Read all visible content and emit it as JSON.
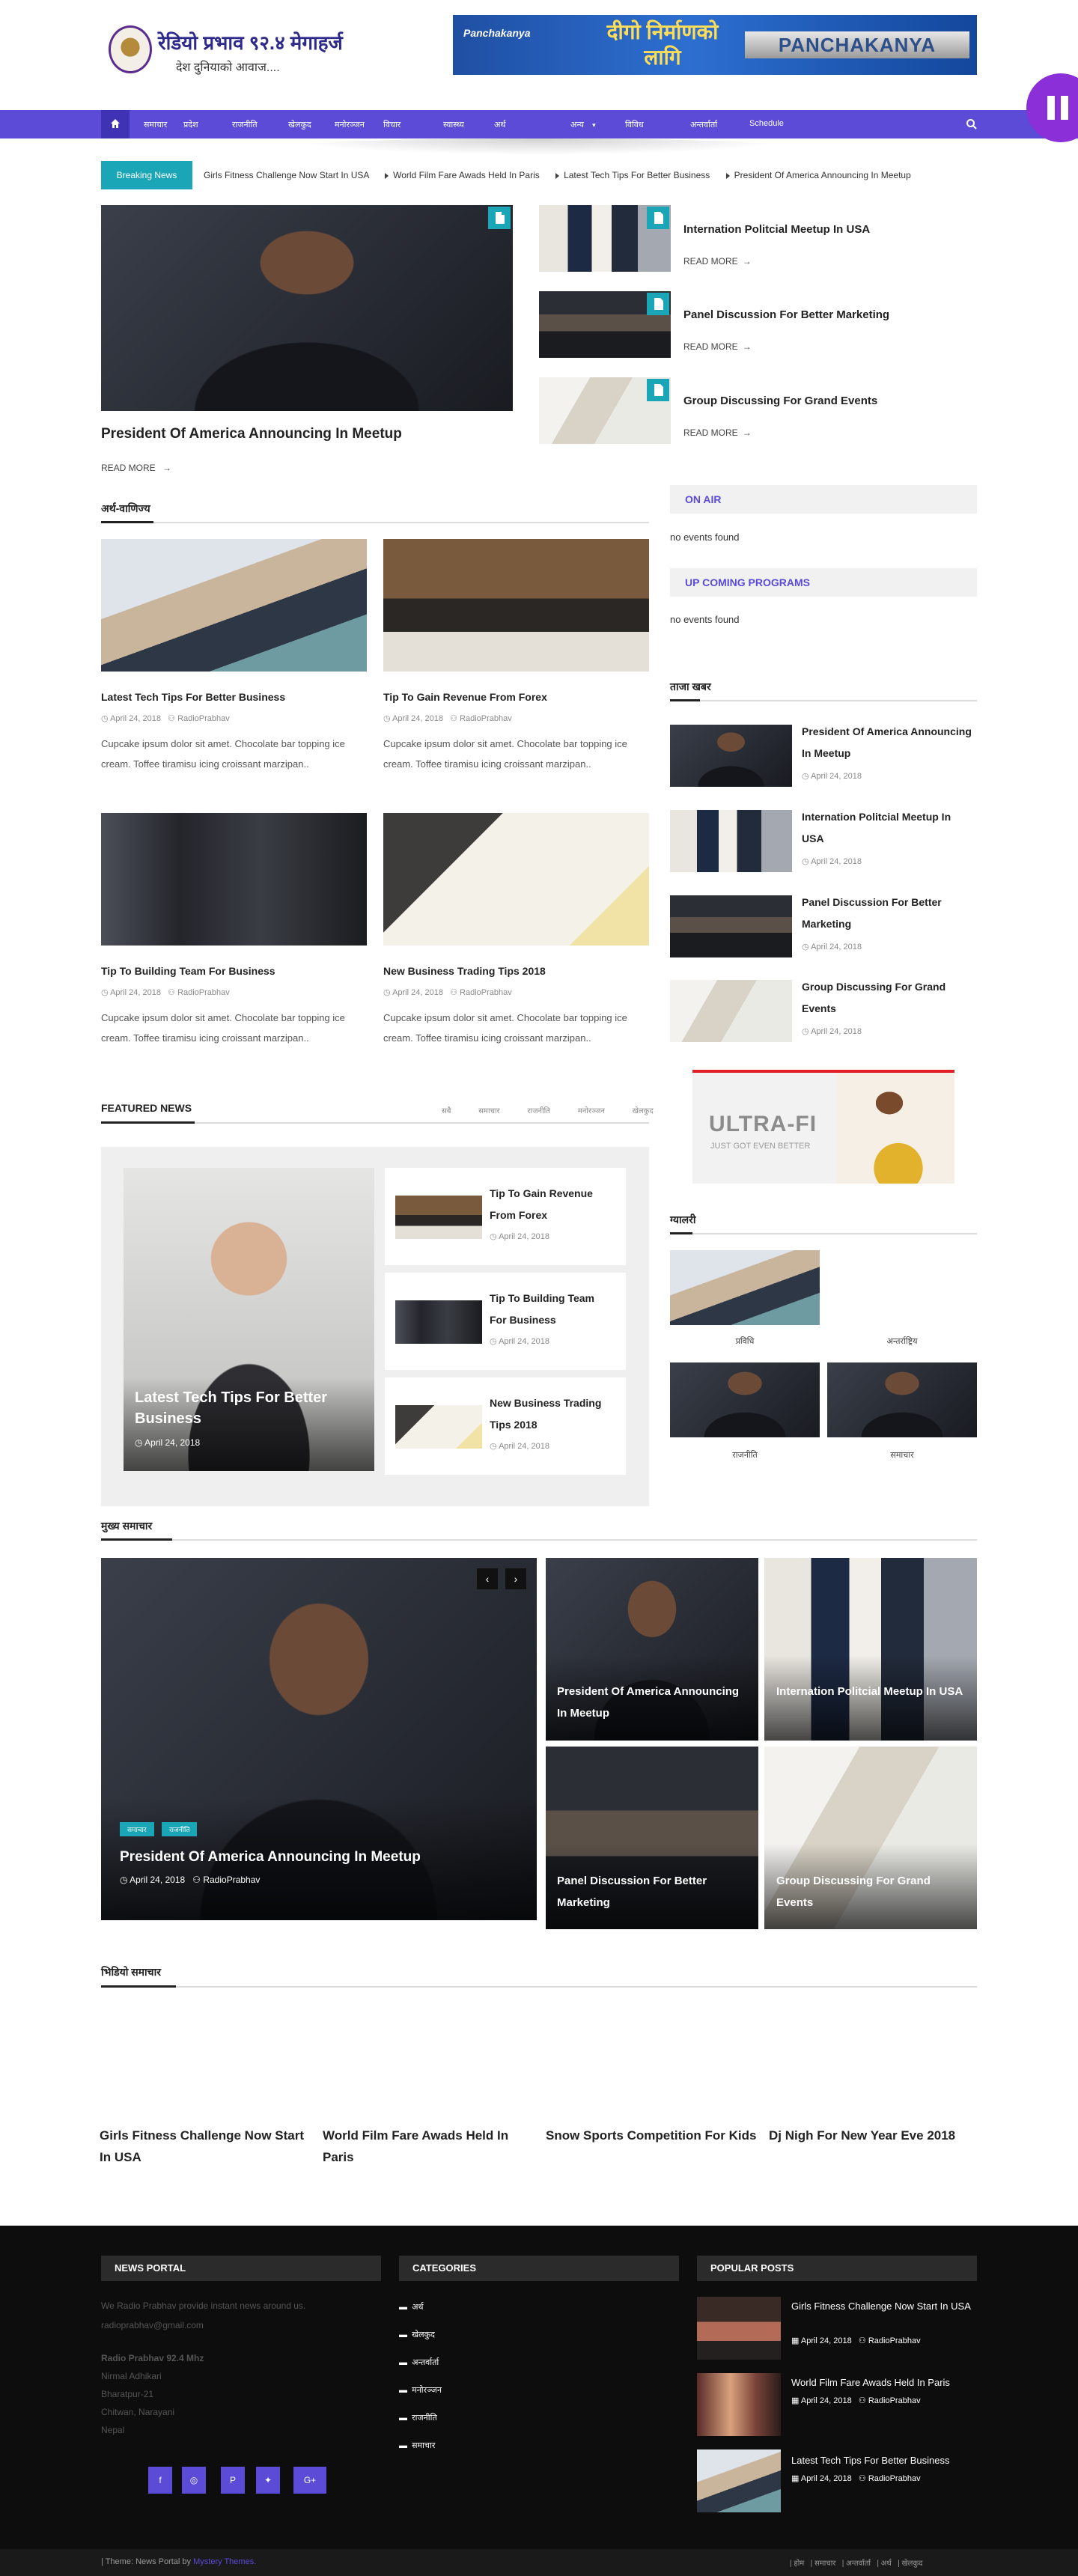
{
  "header": {
    "logo_line1": "रेडियो प्रभाव ९२.४ मेगाहर्ज",
    "logo_line2": "देश दुनियाको आवाज....",
    "ad_brand": "Panchakanya",
    "ad_text": "दीगो निर्माणको लागि",
    "ad_logo": "PANCHAKANYA"
  },
  "nav": {
    "items": [
      "होम",
      "समाचार",
      "प्रदेश",
      "राजनीति",
      "खेलकुद",
      "मनोरञ्जन",
      "विचार",
      "स्वास्थ्य",
      "अर्थ",
      "विविध",
      "अन्तर्वार्ता",
      "Schedule"
    ],
    "more_label": "अन्य"
  },
  "breaking": {
    "label": "Breaking News",
    "items": [
      "Girls Fitness Challenge Now Start In USA",
      "World Film Fare Awads Held In Paris",
      "Latest Tech Tips For Better Business",
      "President Of America Announcing In Meetup"
    ]
  },
  "hero": {
    "title": "President Of America Announcing In Meetup",
    "read_more": "READ MORE"
  },
  "hero_side": [
    {
      "title": "Internation Politcial Meetup In USA",
      "read_more": "READ MORE"
    },
    {
      "title": "Panel Discussion For Better Marketing",
      "read_more": "READ MORE"
    },
    {
      "title": "Group Discussing For Grand Events",
      "read_more": "READ MORE"
    }
  ],
  "section_business": {
    "title": "अर्थ-वाणिज्य",
    "posts": [
      {
        "title": "Latest Tech Tips For Better Business",
        "date": "April 24, 2018",
        "author": "RadioPrabhav",
        "excerpt": "Cupcake ipsum dolor sit amet. Chocolate bar topping ice cream. Toffee tiramisu icing croissant marzipan.."
      },
      {
        "title": "Tip To Gain Revenue From Forex",
        "date": "April 24, 2018",
        "author": "RadioPrabhav",
        "excerpt": "Cupcake ipsum dolor sit amet. Chocolate bar topping ice cream. Toffee tiramisu icing croissant marzipan.."
      },
      {
        "title": "Tip To Building Team For Business",
        "date": "April 24, 2018",
        "author": "RadioPrabhav",
        "excerpt": "Cupcake ipsum dolor sit amet. Chocolate bar topping ice cream. Toffee tiramisu icing croissant marzipan.."
      },
      {
        "title": "New Business Trading Tips 2018",
        "date": "April 24, 2018",
        "author": "RadioPrabhav",
        "excerpt": "Cupcake ipsum dolor sit amet. Chocolate bar topping ice cream. Toffee tiramisu icing croissant marzipan.."
      }
    ]
  },
  "featured": {
    "title": "FEATURED NEWS",
    "tabs": [
      "सबै",
      "समाचार",
      "राजनीति",
      "मनोरञ्जन",
      "खेलकुद"
    ],
    "main": {
      "title": "Latest Tech Tips For Better Business",
      "date": "April 24, 2018"
    },
    "list": [
      {
        "title": "Tip To Gain Revenue From Forex",
        "date": "April 24, 2018"
      },
      {
        "title": "Tip To Building Team For Business",
        "date": "April 24, 2018"
      },
      {
        "title": "New Business Trading Tips 2018",
        "date": "April 24, 2018"
      }
    ]
  },
  "sidebar": {
    "on_air": "ON AIR",
    "on_air_msg": "no events found",
    "upcoming": "UP COMING PROGRAMS",
    "upcoming_msg": "no events found",
    "recent_title": "ताजा खबर",
    "recent": [
      {
        "title": "President Of America Announcing In Meetup",
        "date": "April 24, 2018"
      },
      {
        "title": "Internation Politcial Meetup In USA",
        "date": "April 24, 2018"
      },
      {
        "title": "Panel Discussion For Better Marketing",
        "date": "April 24, 2018"
      },
      {
        "title": "Group Discussing For Grand Events",
        "date": "April 24, 2018"
      }
    ],
    "ad_brand": "ULTRA-FI",
    "ad_tagline": "JUST GOT EVEN BETTER",
    "gallery_title": "ग्यालरी",
    "gallery": [
      "प्रविधि",
      "अन्तर्राष्ट्रिय",
      "राजनीति",
      "समाचार"
    ]
  },
  "slider_section": {
    "title": "मुख्य समाचार",
    "main": {
      "tags": [
        "समाचार",
        "राजनीति"
      ],
      "title": "President Of America Announcing In Meetup",
      "date": "April 24, 2018",
      "author": "RadioPrabhav"
    },
    "grid": [
      "President Of America Announcing In Meetup",
      "Internation Politcial Meetup In USA",
      "Panel Discussion For Better Marketing",
      "Group Discussing For Grand Events"
    ]
  },
  "video_section": {
    "title": "भिडियो समाचार",
    "items": [
      "Girls Fitness Challenge Now Start In USA",
      "World Film Fare Awads Held In Paris",
      "Snow Sports Competition For Kids",
      "Dj Nigh For New Year Eve 2018"
    ]
  },
  "footer": {
    "col1_title": "NEWS PORTAL",
    "about": "We Radio Prabhav provide instant news around us.",
    "email": "radioprabhav@gmail.com",
    "address": [
      "Radio Prabhav 92.4 Mhz",
      "Nirmal Adhikari",
      "Bharatpur-21",
      "Chitwan, Narayani",
      "Nepal"
    ],
    "social": [
      "f",
      "◎",
      "P",
      "♥",
      "G+"
    ],
    "col2_title": "CATEGORIES",
    "categories": [
      "अर्थ",
      "खेलकुद",
      "अन्तर्वार्ता",
      "मनोरञ्जन",
      "राजनीति",
      "समाचार"
    ],
    "col3_title": "POPULAR POSTS",
    "popular": [
      {
        "title": "Girls Fitness Challenge Now Start In USA",
        "date": "April 24, 2018",
        "author": "RadioPrabhav"
      },
      {
        "title": "World Film Fare Awads Held In Paris",
        "date": "April 24, 2018",
        "author": "RadioPrabhav"
      },
      {
        "title": "Latest Tech Tips For Better Business",
        "date": "April 24, 2018",
        "author": "RadioPrabhav"
      }
    ]
  },
  "bottom_bar": {
    "credit_prefix": "| Theme: News Portal by",
    "credit_link": "Mystery Themes.",
    "links": [
      "होम",
      "समाचार",
      "अन्तर्वार्ता",
      "अर्थ",
      "खेलकुद"
    ]
  },
  "colors": {
    "accent": "#5b4bd6",
    "teal": "#1aa6b7",
    "dark": "#0d0d0d"
  }
}
